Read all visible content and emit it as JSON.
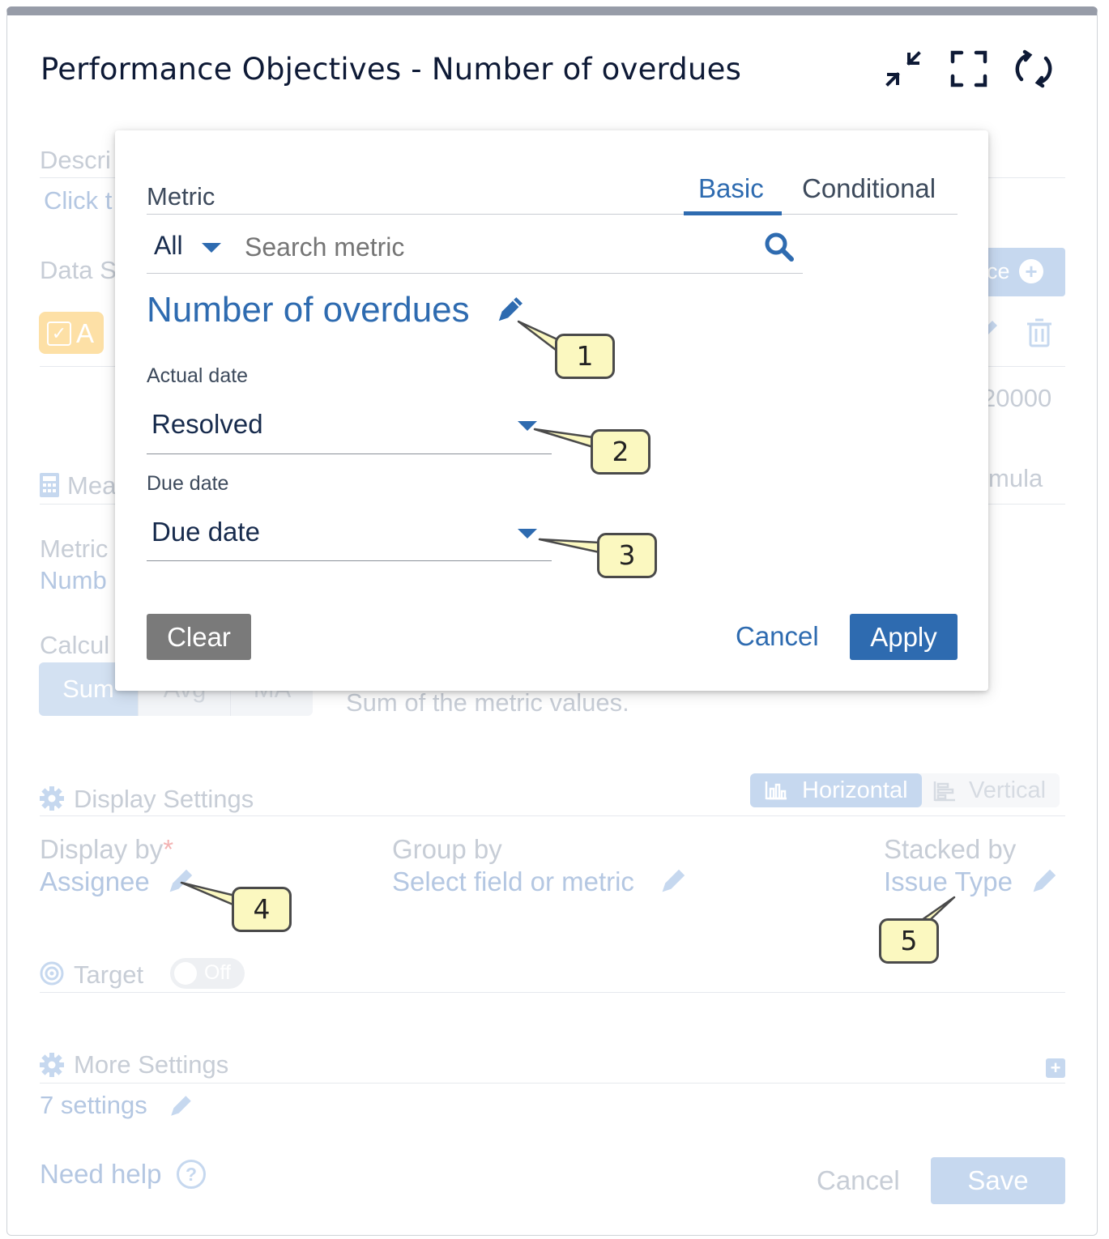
{
  "window": {
    "title": "Performance Objectives - Number of overdues",
    "icons": [
      "collapse-icon",
      "fullscreen-icon",
      "refresh-icon"
    ]
  },
  "background": {
    "description_label": "Descri",
    "description_link": "Click t",
    "data_source_label": "Data S",
    "data_source_button": "ce",
    "source_chip": "A",
    "value_right": "20000",
    "measures_label": "Mea",
    "formula_text": "mula",
    "metric_label": "Metric",
    "metric_value": "Numb",
    "calc_label": "Calcul",
    "calc_options": [
      "Sum",
      "Avg",
      "MA"
    ],
    "calc_description": "Sum of the metric values.",
    "display_settings": {
      "title": "Display Settings",
      "orientation": [
        "Horizontal",
        "Vertical"
      ],
      "display_by_label": "Display by",
      "display_by_required": "*",
      "display_by_value": "Assignee",
      "group_by_label": "Group by",
      "group_by_value": "Select field or metric",
      "stacked_by_label": "Stacked by",
      "stacked_by_value": "Issue Type"
    },
    "target": {
      "label": "Target",
      "toggle": "Off"
    },
    "more_settings": {
      "title": "More Settings",
      "link": "7 settings"
    },
    "need_help": "Need help",
    "footer": {
      "cancel": "Cancel",
      "save": "Save"
    }
  },
  "modal": {
    "metric_label": "Metric",
    "tabs": [
      {
        "label": "Basic",
        "active": true
      },
      {
        "label": "Conditional",
        "active": false
      }
    ],
    "filter_all": "All",
    "search_placeholder": "Search metric",
    "metric_name": "Number of overdues",
    "actual_date": {
      "label": "Actual date",
      "value": "Resolved"
    },
    "due_date": {
      "label": "Due date",
      "value": "Due date"
    },
    "buttons": {
      "clear": "Clear",
      "cancel": "Cancel",
      "apply": "Apply"
    }
  },
  "callouts": [
    "1",
    "2",
    "3",
    "4",
    "5"
  ],
  "colors": {
    "accent": "#2e6bb0",
    "link": "#2e6bb0",
    "faded_link": "#b4c7e2",
    "faded_text": "#c7cdd6",
    "callout_fill": "#fbf8c0",
    "clear_button": "#7a7a7a",
    "chip": "#fde0a6"
  }
}
